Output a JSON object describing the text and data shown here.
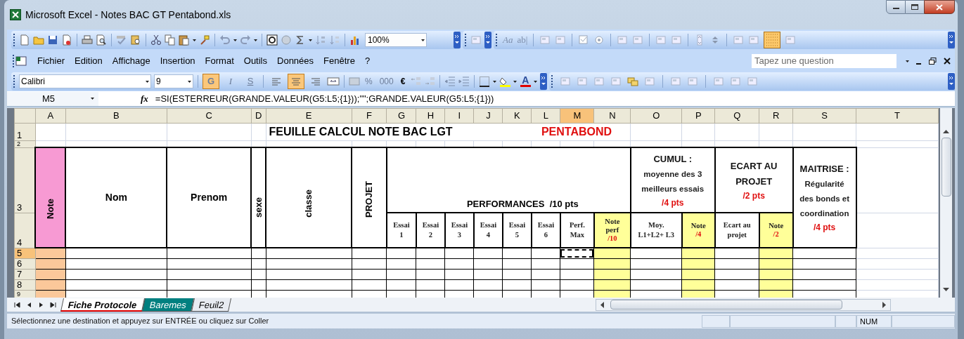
{
  "window": {
    "title": "Microsoft Excel - Notes BAC GT Pentabond.xls"
  },
  "standard_toolbar": {
    "zoom": "100%",
    "form_controls": [
      "Aa",
      "ab|"
    ]
  },
  "menu_bar": {
    "items": [
      "Fichier",
      "Edition",
      "Affichage",
      "Insertion",
      "Format",
      "Outils",
      "Données",
      "Fenêtre",
      "?"
    ],
    "help_placeholder": "Tapez une question"
  },
  "format_toolbar": {
    "font": "Calibri",
    "size": "9",
    "style_buttons": [
      {
        "label": "G",
        "kind": "bold",
        "selected": true
      },
      {
        "label": "I",
        "kind": "italic",
        "selected": false
      },
      {
        "label": "S",
        "kind": "underline",
        "selected": false
      }
    ],
    "alignments": [
      {
        "kind": "left",
        "selected": false
      },
      {
        "kind": "center",
        "selected": true
      },
      {
        "kind": "right",
        "selected": false
      }
    ],
    "number_labels": [
      "%",
      "000",
      "€"
    ],
    "font_color_label": "A"
  },
  "formula_bar": {
    "cell": "M5",
    "function_label": "fx",
    "formula": "=SI(ESTERREUR(GRANDE.VALEUR(G5:L5;{1}));\"\";GRANDE.VALEUR(G5:L5;{1}))"
  },
  "columns": [
    {
      "label": "A",
      "selected": false
    },
    {
      "label": "B",
      "selected": false
    },
    {
      "label": "C",
      "selected": false
    },
    {
      "label": "D",
      "selected": false
    },
    {
      "label": "E",
      "selected": false
    },
    {
      "label": "F",
      "selected": false
    },
    {
      "label": "G",
      "selected": false
    },
    {
      "label": "H",
      "selected": false
    },
    {
      "label": "I",
      "selected": false
    },
    {
      "label": "J",
      "selected": false
    },
    {
      "label": "K",
      "selected": false
    },
    {
      "label": "L",
      "selected": false
    },
    {
      "label": "M",
      "selected": true
    },
    {
      "label": "N",
      "selected": false
    },
    {
      "label": "O",
      "selected": false
    },
    {
      "label": "P",
      "selected": false
    },
    {
      "label": "Q",
      "selected": false
    },
    {
      "label": "R",
      "selected": false
    },
    {
      "label": "S",
      "selected": false
    },
    {
      "label": "T",
      "selected": false
    }
  ],
  "rows": [
    {
      "label": "1",
      "selected": false
    },
    {
      "label": "2",
      "selected": false
    },
    {
      "label": "3",
      "selected": false
    },
    {
      "label": "4",
      "selected": false
    },
    {
      "label": "5",
      "selected": true
    },
    {
      "label": "6",
      "selected": false
    },
    {
      "label": "7",
      "selected": false
    },
    {
      "label": "8",
      "selected": false
    },
    {
      "label": "9",
      "selected": false
    }
  ],
  "sheet": {
    "title": "FEUILLE CALCUL NOTE BAC LGT",
    "subtitle": "PENTABOND",
    "headers": [
      {
        "text": "Note"
      },
      {
        "text": "Nom"
      },
      {
        "text": "Prenom"
      },
      {
        "text": "sexe"
      },
      {
        "text": "classe"
      },
      {
        "text": "PROJET"
      },
      {
        "text": "PERFORMANCES  /10 pts"
      },
      {
        "title": "CUMUL :",
        "lines": [
          "moyenne des 3",
          "meilleurs essais"
        ],
        "points": "/4 pts"
      },
      {
        "title": "ECART AU PROJET",
        "points": "/2 pts"
      },
      {
        "title": "MAITRISE :",
        "lines": [
          "Régularité",
          "des bonds et",
          "coordination"
        ],
        "points": "/4 pts"
      }
    ],
    "subheaders": [
      {
        "kind": "plain",
        "lines": [
          "Essai",
          "1"
        ]
      },
      {
        "kind": "plain",
        "lines": [
          "Essai",
          "2"
        ]
      },
      {
        "kind": "plain",
        "lines": [
          "Essai",
          "3"
        ]
      },
      {
        "kind": "plain",
        "lines": [
          "Essai",
          "4"
        ]
      },
      {
        "kind": "plain",
        "lines": [
          "Essai",
          "5"
        ]
      },
      {
        "kind": "plain",
        "lines": [
          "Essai",
          "6"
        ]
      },
      {
        "kind": "plain",
        "lines": [
          "Perf.",
          "Max"
        ]
      },
      {
        "kind": "score",
        "lines": [
          "Note",
          "perf"
        ],
        "points": "/10"
      },
      {
        "kind": "plain",
        "lines": [
          "Moy.",
          "L1+L2+ L3"
        ]
      },
      {
        "kind": "score",
        "lines": [
          "Note"
        ],
        "points": "/4"
      },
      {
        "kind": "plain",
        "lines": [
          "Ecart au",
          "projet"
        ]
      },
      {
        "kind": "score",
        "lines": [
          "Note"
        ],
        "points": "/2"
      }
    ]
  },
  "sheet_tabs": [
    {
      "label": "Fiche Protocole",
      "selected": true
    },
    {
      "label": "Baremes",
      "selected": false,
      "color": "#008080"
    },
    {
      "label": "Feuil2",
      "selected": false
    }
  ],
  "status_bar": {
    "text": "Sélectionnez une destination et appuyez sur ENTRÉE ou cliquez sur Coller",
    "indicators": [
      "NUM"
    ]
  }
}
